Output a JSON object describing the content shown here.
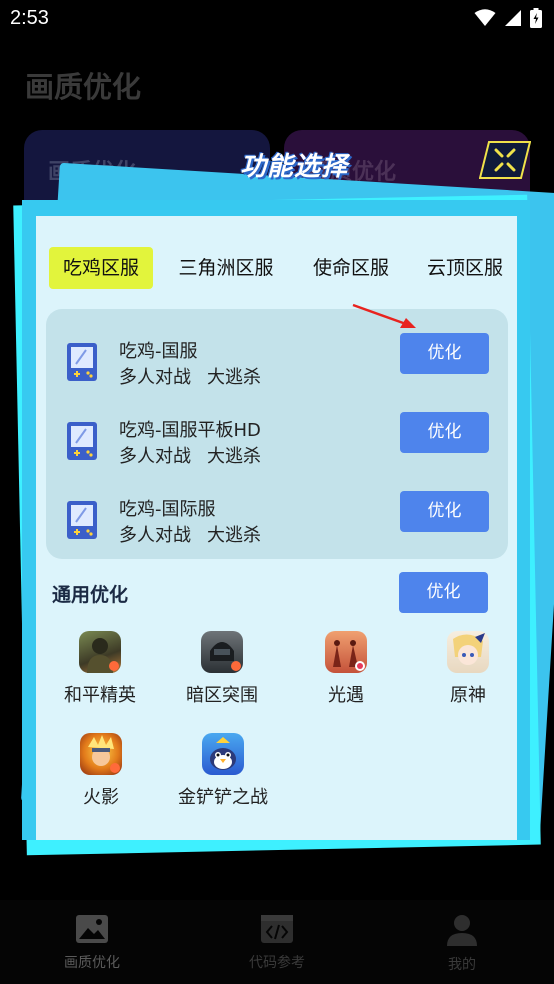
{
  "status_bar": {
    "time": "2:53"
  },
  "background": {
    "page_title": "画质优化",
    "card_left_label": "画质优化",
    "card_right_label": "画质优化"
  },
  "bottom_nav": {
    "items": [
      {
        "label": "画质优化",
        "icon": "image-icon"
      },
      {
        "label": "代码参考",
        "icon": "code-icon"
      },
      {
        "label": "我的",
        "icon": "person-icon"
      }
    ]
  },
  "dialog": {
    "title": "功能选择",
    "tabs": [
      {
        "label": "吃鸡区服",
        "selected": true
      },
      {
        "label": "三角洲区服",
        "selected": false
      },
      {
        "label": "使命区服",
        "selected": false
      },
      {
        "label": "云顶区服",
        "selected": false
      }
    ],
    "servers": [
      {
        "name": "吃鸡-国服",
        "tags": [
          "多人对战",
          "大逃杀"
        ],
        "button": "优化"
      },
      {
        "name": "吃鸡-国服平板HD",
        "tags": [
          "多人对战",
          "大逃杀"
        ],
        "button": "优化"
      },
      {
        "name": "吃鸡-国际服",
        "tags": [
          "多人对战",
          "大逃杀"
        ],
        "button": "优化"
      }
    ],
    "general": {
      "label": "通用优化",
      "button": "优化"
    },
    "games": [
      {
        "label": "和平精英",
        "icon": "peace-elite-icon"
      },
      {
        "label": "暗区突围",
        "icon": "arena-breakout-icon"
      },
      {
        "label": "光遇",
        "icon": "sky-icon"
      },
      {
        "label": "原神",
        "icon": "genshin-icon"
      },
      {
        "label": "火影",
        "icon": "naruto-icon"
      },
      {
        "label": "金铲铲之战",
        "icon": "golden-spatula-icon"
      }
    ]
  },
  "colors": {
    "accent_button": "#4e84ec",
    "selected_tab": "#e2f43c",
    "dialog_frame": "#37c9f0",
    "panel_bg": "#dcf4fb"
  }
}
